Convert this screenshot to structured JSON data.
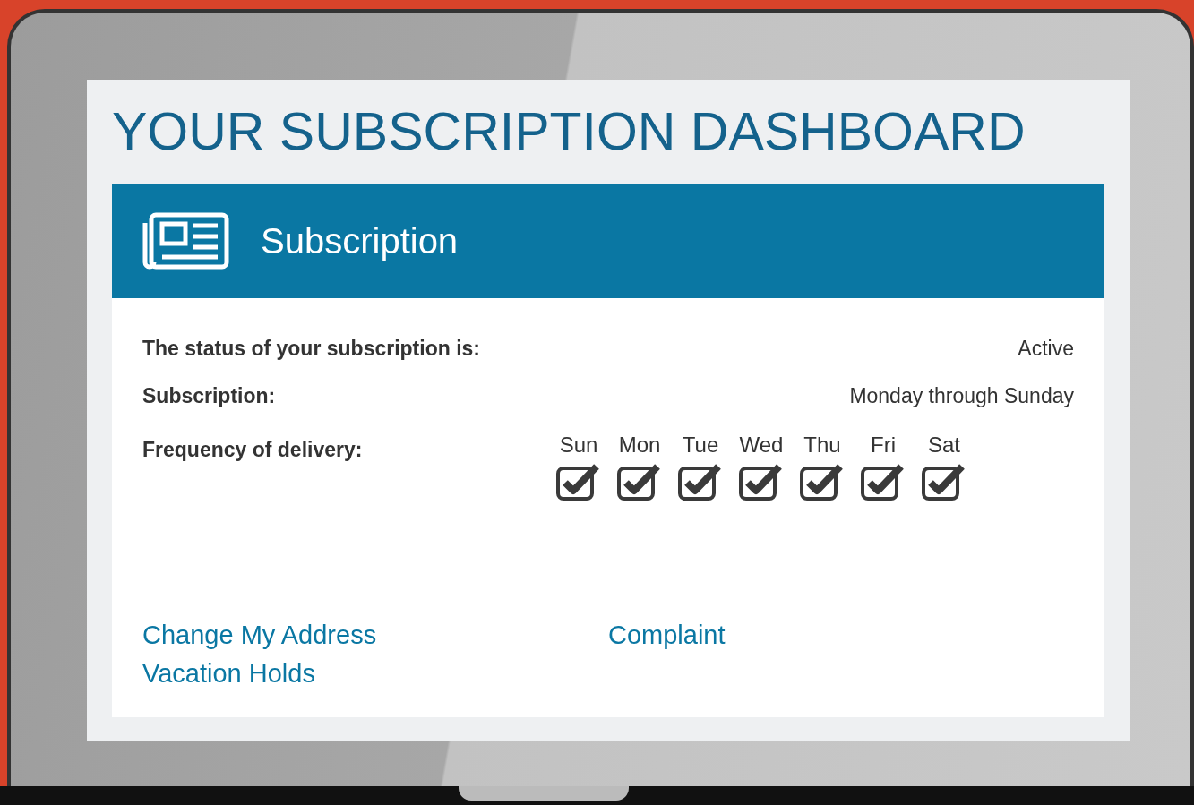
{
  "title": "YOUR SUBSCRIPTION DASHBOARD",
  "card": {
    "heading": "Subscription",
    "rows": [
      {
        "label": "The status of your subscription is:",
        "value": "Active"
      },
      {
        "label": "Subscription:",
        "value": "Monday through Sunday"
      }
    ],
    "frequency": {
      "label": "Frequency of delivery:",
      "days": [
        {
          "label": "Sun",
          "checked": true
        },
        {
          "label": "Mon",
          "checked": true
        },
        {
          "label": "Tue",
          "checked": true
        },
        {
          "label": "Wed",
          "checked": true
        },
        {
          "label": "Thu",
          "checked": true
        },
        {
          "label": "Fri",
          "checked": true
        },
        {
          "label": "Sat",
          "checked": true
        }
      ]
    },
    "links": [
      {
        "label": "Change My Address"
      },
      {
        "label": "Complaint"
      },
      {
        "label": "Vacation Holds"
      }
    ]
  }
}
